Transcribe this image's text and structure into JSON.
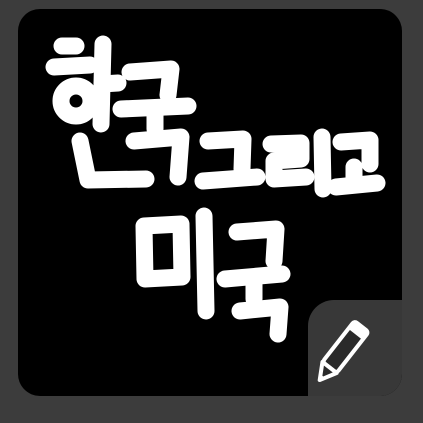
{
  "app_icon": {
    "logo_text": "한국 그리고 미국",
    "background_color": "#000000",
    "lettering_color": "#ffffff",
    "badge": {
      "icon": "pencil-icon",
      "background_color": "#383838",
      "icon_color": "#ffffff"
    }
  }
}
